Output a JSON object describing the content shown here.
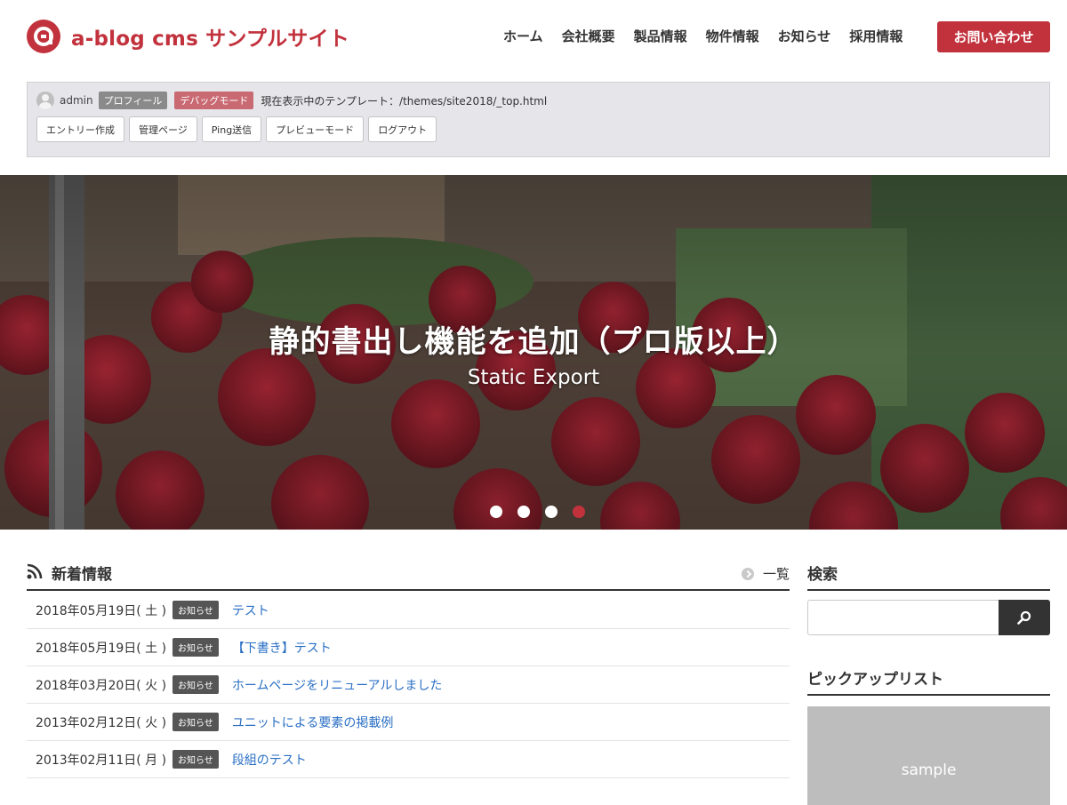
{
  "header": {
    "logo_text": "a-blog cms サンプルサイト",
    "nav": [
      "ホーム",
      "会社概要",
      "製品情報",
      "物件情報",
      "お知らせ",
      "採用情報"
    ],
    "contact_label": "お問い合わせ",
    "brand_color": "#c2323d"
  },
  "admin_bar": {
    "user": "admin",
    "profile_tag": "プロフィール",
    "debug_tag": "デバッグモード",
    "template_info": "現在表示中のテンプレート：/themes/site2018/_top.html",
    "buttons": [
      "エントリー作成",
      "管理ページ",
      "Ping送信",
      "プレビューモード",
      "ログアウト"
    ]
  },
  "hero": {
    "title": "静的書出し機能を追加（プロ版以上）",
    "subtitle": "Static Export",
    "slide_count": 4,
    "active_slide": 4
  },
  "news": {
    "title": "新着情報",
    "more_label": "一覧",
    "items": [
      {
        "date": "2018年05月19日( 土 )",
        "category": "お知らせ",
        "title": "テスト"
      },
      {
        "date": "2018年05月19日( 土 )",
        "category": "お知らせ",
        "title": "【下書き】テスト"
      },
      {
        "date": "2018年03月20日( 火 )",
        "category": "お知らせ",
        "title": "ホームページをリニューアルしました"
      },
      {
        "date": "2013年02月12日( 火 )",
        "category": "お知らせ",
        "title": "ユニットによる要素の掲載例"
      },
      {
        "date": "2013年02月11日( 月 )",
        "category": "お知らせ",
        "title": "段組のテスト"
      }
    ]
  },
  "sidebar": {
    "search_title": "検索",
    "search_value": "",
    "pickup_title": "ピックアップリスト",
    "pickup_image_label": "sample"
  }
}
